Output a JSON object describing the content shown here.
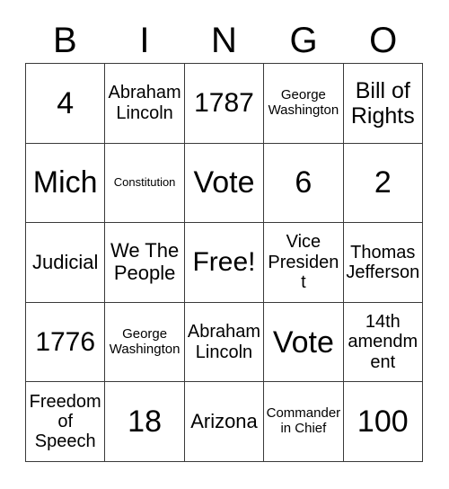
{
  "header": {
    "letters": [
      "B",
      "I",
      "N",
      "G",
      "O"
    ]
  },
  "grid": {
    "columns": 5,
    "rows": 5,
    "free_space": {
      "row": 3,
      "column": 3,
      "label": "Free!"
    },
    "cells": [
      {
        "text": "4",
        "size": "fs-xxl"
      },
      {
        "text": "Abraham Lincoln",
        "size": "fs-s"
      },
      {
        "text": "1787",
        "size": "fs-xl"
      },
      {
        "text": "George Washington",
        "size": "fs-xs"
      },
      {
        "text": "Bill of Rights",
        "size": "fs-l"
      },
      {
        "text": "Mich",
        "size": "fs-xxl"
      },
      {
        "text": "Constitution",
        "size": "fs-xxs"
      },
      {
        "text": "Vote",
        "size": "fs-xxl"
      },
      {
        "text": "6",
        "size": "fs-xxl"
      },
      {
        "text": "2",
        "size": "fs-xxl"
      },
      {
        "text": "Judicial",
        "size": "fs-m"
      },
      {
        "text": "We The People",
        "size": "fs-m"
      },
      {
        "text": "Free!",
        "size": "fs-xl"
      },
      {
        "text": "Vice President",
        "size": "fs-s"
      },
      {
        "text": "Thomas Jefferson",
        "size": "fs-s"
      },
      {
        "text": "1776",
        "size": "fs-xl"
      },
      {
        "text": "George Washington",
        "size": "fs-xs"
      },
      {
        "text": "Abraham Lincoln",
        "size": "fs-s"
      },
      {
        "text": "Vote",
        "size": "fs-xxl"
      },
      {
        "text": "14th amendment",
        "size": "fs-s"
      },
      {
        "text": "Freedom of Speech",
        "size": "fs-s"
      },
      {
        "text": "18",
        "size": "fs-xxl"
      },
      {
        "text": "Arizona",
        "size": "fs-m"
      },
      {
        "text": "Commander in Chief",
        "size": "fs-xs"
      },
      {
        "text": "100",
        "size": "fs-xxl"
      }
    ]
  },
  "colors": {
    "background": "#ffffff",
    "text": "#000000",
    "grid_line": "#3a3a3a"
  }
}
